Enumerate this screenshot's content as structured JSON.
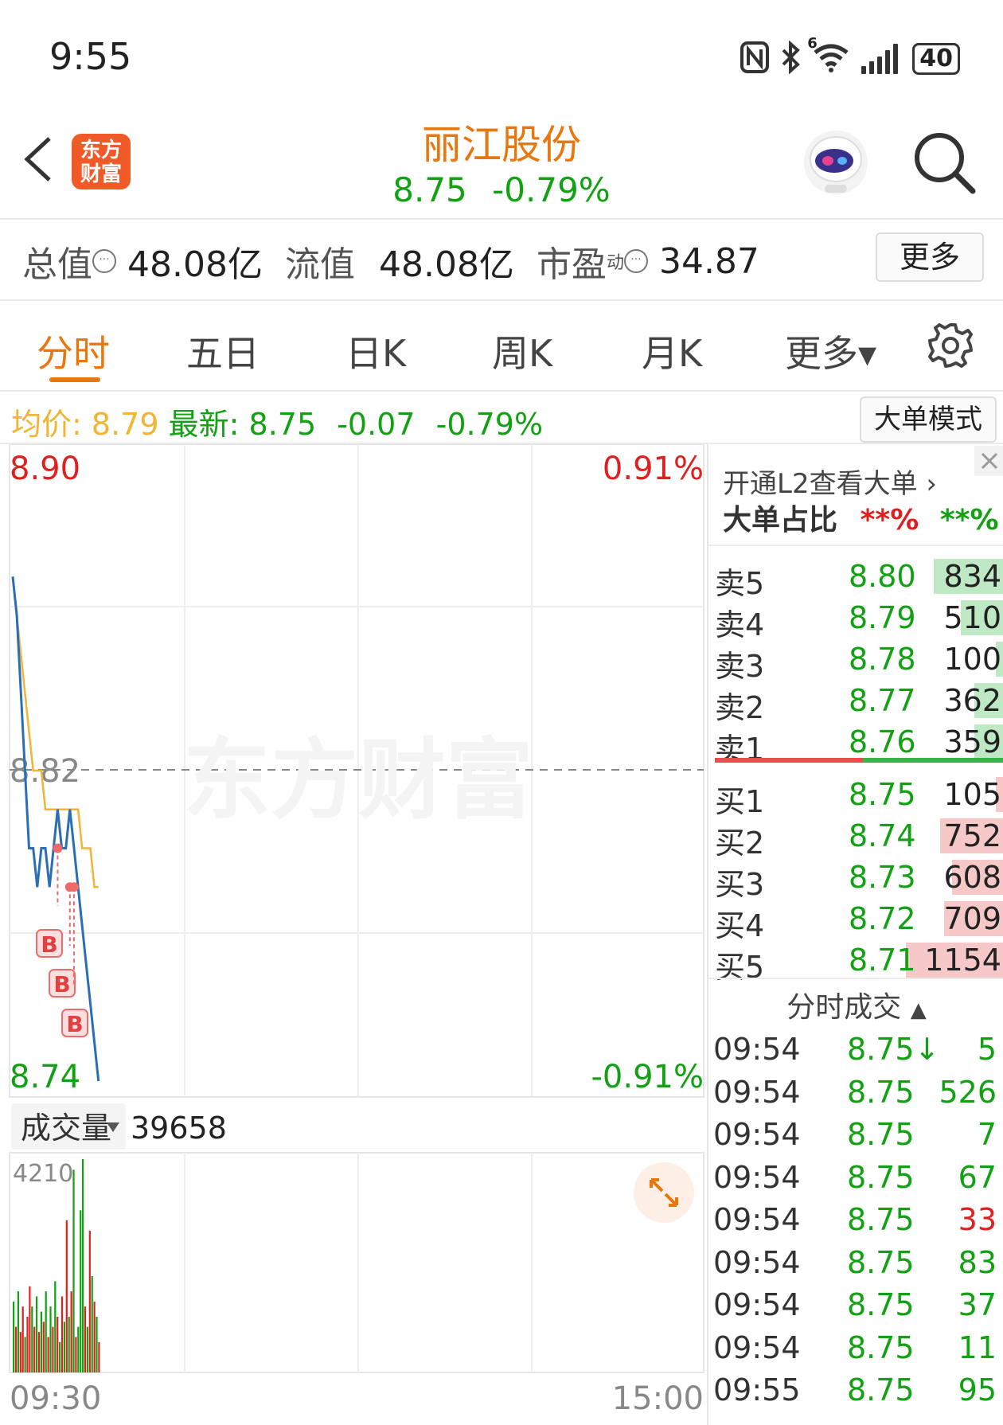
{
  "status_bar": {
    "time": "9:55",
    "battery": "40",
    "wifi_badge": "6"
  },
  "header": {
    "logo_line1": "东方",
    "logo_line2": "财富",
    "stock_name": "丽江股份",
    "price": "8.75",
    "change_pct": "-0.79%"
  },
  "metrics": {
    "total_value_label": "总值",
    "total_value": "48.08亿",
    "float_value_label": "流值",
    "float_value": "48.08亿",
    "pe_label": "市盈",
    "pe_superscript": "动",
    "pe_value": "34.87",
    "more_label": "更多"
  },
  "tabs": [
    {
      "label": "分时",
      "active": true
    },
    {
      "label": "五日",
      "active": false
    },
    {
      "label": "日K",
      "active": false
    },
    {
      "label": "周K",
      "active": false
    },
    {
      "label": "月K",
      "active": false
    },
    {
      "label": "更多▾",
      "active": false
    }
  ],
  "avg_row": {
    "avg_label": "均价:",
    "avg_value": "8.79",
    "latest_label": "最新:",
    "latest_value": "8.75",
    "change": "-0.07",
    "change_pct": "-0.79%",
    "big_order_mode": "大单模式"
  },
  "chart": {
    "y_high": "8.90",
    "y_mid": "8.82",
    "y_low": "8.74",
    "pct_high": "0.91%",
    "pct_low": "-0.91%",
    "watermark": "东方财富",
    "volume_label": "成交量",
    "volume_value": "39658",
    "volume_max": "4210",
    "x_start": "09:30",
    "x_end": "15:00",
    "buy_marker": "B"
  },
  "chart_data": {
    "type": "line",
    "y_range": [
      8.74,
      8.9
    ],
    "prev_close": 8.82,
    "price_series": [
      8.87,
      8.86,
      8.84,
      8.82,
      8.8,
      8.8,
      8.79,
      8.8,
      8.8,
      8.79,
      8.8,
      8.81,
      8.8,
      8.8,
      8.81,
      8.8,
      8.79,
      8.78,
      8.77,
      8.76,
      8.75,
      8.74
    ],
    "avg_series": [
      8.87,
      8.86,
      8.85,
      8.84,
      8.83,
      8.82,
      8.82,
      8.82,
      8.81,
      8.81,
      8.81,
      8.81,
      8.81,
      8.81,
      8.81,
      8.81,
      8.81,
      8.8,
      8.8,
      8.8,
      8.79,
      8.79
    ],
    "volume_series": [
      1400,
      900,
      1600,
      800,
      1300,
      700,
      1100,
      1700,
      1300,
      900,
      1500,
      800,
      1200,
      1000,
      1600,
      700,
      1300,
      900,
      1800,
      1100,
      600,
      1500,
      1000,
      3000,
      1100,
      1600,
      4000,
      700,
      900,
      3200,
      4210,
      1300,
      900,
      2800,
      1900,
      1400,
      1100,
      600
    ],
    "volume_colors": [
      "g",
      "r",
      "g",
      "r",
      "r",
      "g",
      "r",
      "r",
      "g",
      "r",
      "g",
      "r",
      "g",
      "r",
      "g",
      "r",
      "g",
      "r",
      "g",
      "r",
      "g",
      "r",
      "g",
      "r",
      "g",
      "r",
      "g",
      "r",
      "g",
      "g",
      "g",
      "r",
      "g",
      "r",
      "g",
      "r",
      "g",
      "r"
    ],
    "buy_markers": [
      {
        "index": 11,
        "price": 8.8
      },
      {
        "index": 14,
        "price": 8.79
      },
      {
        "index": 15,
        "price": 8.79
      }
    ]
  },
  "panel": {
    "l2_link": "开通L2查看大单",
    "big_ratio_label": "大单占比",
    "big_ratio_sell": "**%",
    "big_ratio_buy": "**%",
    "asks": [
      {
        "label": "卖5",
        "price": "8.80",
        "volume": "834",
        "bar_color": "#bfe8c4",
        "bar_frac": 0.72
      },
      {
        "label": "卖4",
        "price": "8.79",
        "volume": "510",
        "bar_color": "#bfe8c4",
        "bar_frac": 0.44
      },
      {
        "label": "卖3",
        "price": "8.78",
        "volume": "100",
        "bar_color": "#bfe8c4",
        "bar_frac": 0.09
      },
      {
        "label": "卖2",
        "price": "8.77",
        "volume": "362",
        "bar_color": "#bfe8c4",
        "bar_frac": 0.31
      },
      {
        "label": "卖1",
        "price": "8.76",
        "volume": "359",
        "bar_color": "#bfe8c4",
        "bar_frac": 0.31
      }
    ],
    "bids": [
      {
        "label": "买1",
        "price": "8.75",
        "volume": "105",
        "bar_color": "#f7c8c8",
        "bar_frac": 0.09
      },
      {
        "label": "买2",
        "price": "8.74",
        "volume": "752",
        "bar_color": "#f7c8c8",
        "bar_frac": 0.65
      },
      {
        "label": "买3",
        "price": "8.73",
        "volume": "608",
        "bar_color": "#f7c8c8",
        "bar_frac": 0.53
      },
      {
        "label": "买4",
        "price": "8.72",
        "volume": "709",
        "bar_color": "#f7c8c8",
        "bar_frac": 0.61
      },
      {
        "label": "买5",
        "price": "8.71",
        "volume": "1154",
        "bar_color": "#f7c8c8",
        "bar_frac": 1.0
      }
    ],
    "trades_header": "分时成交",
    "trades": [
      {
        "time": "09:54",
        "price": "8.75↓",
        "volume": "5",
        "dir": "green"
      },
      {
        "time": "09:54",
        "price": "8.75",
        "volume": "526",
        "dir": "green"
      },
      {
        "time": "09:54",
        "price": "8.75",
        "volume": "7",
        "dir": "green"
      },
      {
        "time": "09:54",
        "price": "8.75",
        "volume": "67",
        "dir": "green"
      },
      {
        "time": "09:54",
        "price": "8.75",
        "volume": "33",
        "dir": "red"
      },
      {
        "time": "09:54",
        "price": "8.75",
        "volume": "83",
        "dir": "green"
      },
      {
        "time": "09:54",
        "price": "8.75",
        "volume": "37",
        "dir": "green"
      },
      {
        "time": "09:54",
        "price": "8.75",
        "volume": "11",
        "dir": "green"
      },
      {
        "time": "09:55",
        "price": "8.75",
        "volume": "95",
        "dir": "green"
      }
    ]
  },
  "colors": {
    "accent": "#e8770e",
    "up": "#e02020",
    "down": "#12a112",
    "price_line": "#2a6fb5",
    "avg_line": "#f2b533"
  }
}
